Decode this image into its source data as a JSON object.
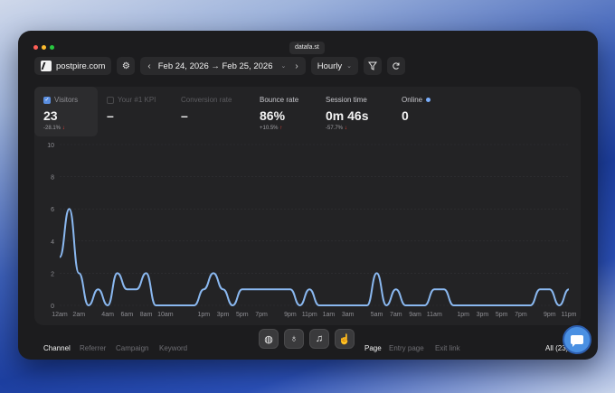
{
  "window": {
    "url": "datafa.st"
  },
  "toolbar": {
    "site": "postpire.com",
    "prev": "‹",
    "next": "›",
    "date_range": "Feb 24, 2026 → Feb 25, 2026",
    "granularity": "Hourly"
  },
  "stats": [
    {
      "label": "Visitors",
      "value": "23",
      "change": "-28.1%",
      "trend": "down",
      "checked": true
    },
    {
      "label": "Your #1 KPI",
      "value": "–",
      "change": "",
      "checked": false
    },
    {
      "label": "Conversion rate",
      "value": "–",
      "change": ""
    },
    {
      "label": "Bounce rate",
      "value": "86%",
      "change": "+10.5%",
      "trend": "up"
    },
    {
      "label": "Session time",
      "value": "0m 46s",
      "change": "-57.7%",
      "trend": "down"
    },
    {
      "label": "Online",
      "value": "0",
      "change": ""
    }
  ],
  "chart_data": {
    "type": "line",
    "ylim": [
      0,
      10
    ],
    "yticks": [
      0,
      2,
      4,
      6,
      8,
      10
    ],
    "x": [
      "12am",
      "1am",
      "2am",
      "3am",
      "4am",
      "5am",
      "6am",
      "7am",
      "8am",
      "9am",
      "10am",
      "11am",
      "12pm",
      "1pm",
      "2pm",
      "3pm",
      "4pm",
      "5pm",
      "6pm",
      "7pm",
      "8pm",
      "9pm",
      "10pm",
      "11pm",
      "12am",
      "1am",
      "2am",
      "3am",
      "4am",
      "5am",
      "6am",
      "7am",
      "8am",
      "9am",
      "10am",
      "11am",
      "12pm",
      "1pm",
      "2pm",
      "3pm",
      "4pm",
      "5pm",
      "6pm",
      "7pm",
      "8pm",
      "9pm",
      "10pm",
      "11pm"
    ],
    "xtick_labels": [
      "12am",
      "2am",
      "4am",
      "6am",
      "8am",
      "10am",
      "1pm",
      "3pm",
      "5pm",
      "7pm",
      "9pm",
      "11pm",
      "1am",
      "3am",
      "5am",
      "7am",
      "9am",
      "11am",
      "1pm",
      "3pm",
      "5pm",
      "7pm",
      "9pm",
      "11pm"
    ],
    "xtick_indices": [
      0,
      2,
      4,
      6,
      8,
      10,
      13,
      15,
      17,
      19,
      21,
      23,
      25,
      27,
      29,
      31,
      33,
      35,
      37,
      39,
      41,
      43,
      45,
      47
    ],
    "series": [
      {
        "values": [
          3,
          6,
          2,
          0,
          1,
          0,
          2,
          1,
          1,
          2,
          0,
          0,
          0,
          0,
          0,
          1,
          2,
          1,
          0,
          1,
          1,
          1,
          1,
          1,
          1,
          0,
          1,
          0,
          0,
          0,
          0,
          0,
          0,
          2,
          0,
          1,
          0,
          0,
          0,
          1,
          1,
          0,
          0,
          0,
          0,
          0,
          0,
          0,
          0,
          0,
          1,
          1,
          0,
          1
        ],
        "color": "#8ab8f0"
      }
    ],
    "grid": true
  },
  "tabs_left": [
    "Channel",
    "Referrer",
    "Campaign",
    "Keyword"
  ],
  "tabs_right": [
    "Page",
    "Entry page",
    "Exit link"
  ],
  "all_count": "All (23)",
  "dock_icons": [
    "globe-icon",
    "lightbulb-icon",
    "bell-icon",
    "thumbs-up-icon"
  ]
}
